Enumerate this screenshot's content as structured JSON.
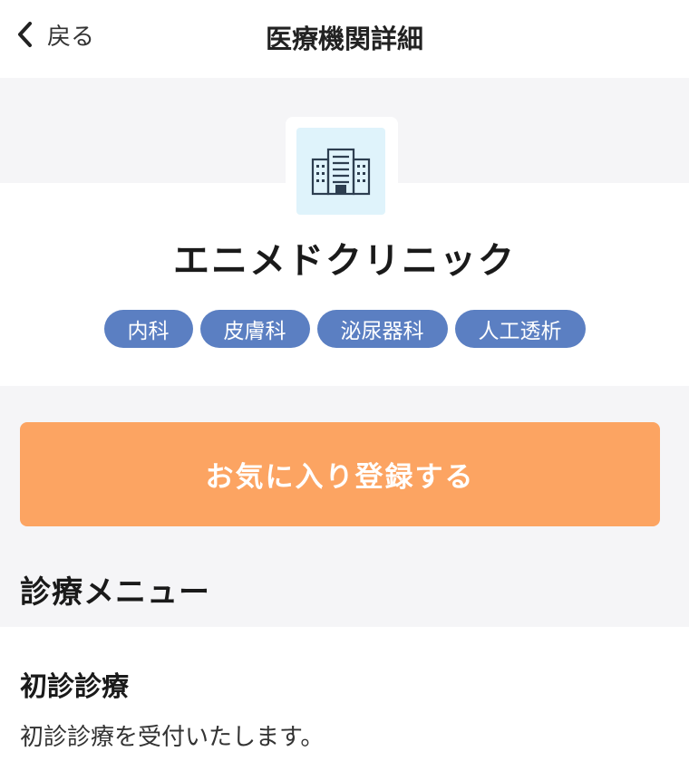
{
  "header": {
    "back_label": "戻る",
    "title": "医療機関詳細"
  },
  "clinic": {
    "logo_icon": "building-icon",
    "name": "エニメドクリニック",
    "departments": [
      "内科",
      "皮膚科",
      "泌尿器科",
      "人工透析"
    ]
  },
  "actions": {
    "favorite_label": "お気に入り登録する"
  },
  "menu_section": {
    "title": "診療メニュー",
    "items": [
      {
        "name": "初診診療",
        "description": "初診診療を受付いたします。"
      }
    ]
  },
  "colors": {
    "accent_orange": "#fca462",
    "tag_blue": "#5b7fc2",
    "logo_bg": "#dff3fb",
    "section_gray": "#f5f5f7"
  }
}
